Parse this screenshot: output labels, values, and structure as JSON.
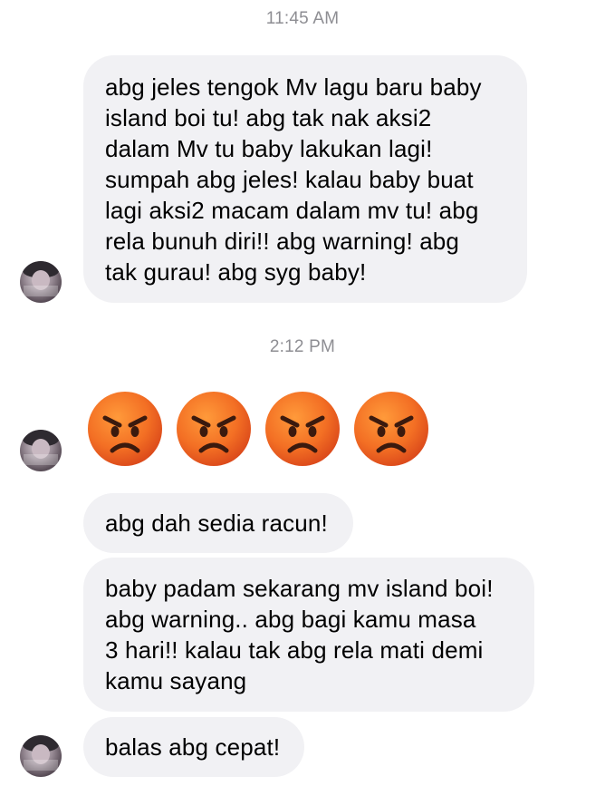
{
  "conversation": {
    "timestamps": [
      "11:45 AM",
      "2:12 PM"
    ],
    "messages": [
      {
        "text": "abg jeles tengok Mv lagu baru baby\nisland boi tu! abg tak nak aksi2\ndalam Mv tu baby lakukan lagi!\nsumpah abg jeles! kalau baby buat\nlagi aksi2 macam dalam mv tu! abg\nrela bunuh diri!! abg warning! abg\ntak gurau! abg syg baby!"
      },
      {
        "text": "abg dah sedia racun!"
      },
      {
        "text": "baby padam sekarang mv island boi!\nabg warning.. abg bagi kamu masa\n3 hari!! kalau tak abg rela mati demi\nkamu sayang"
      },
      {
        "text": "balas abg cepat!"
      }
    ],
    "emoji_message": {
      "icon": "angry-face-emoji",
      "count": 4
    }
  },
  "colors": {
    "bubble_background": "#f1f1f4",
    "timestamp_text": "#8e8e93",
    "emoji_face": "#f36f24"
  }
}
